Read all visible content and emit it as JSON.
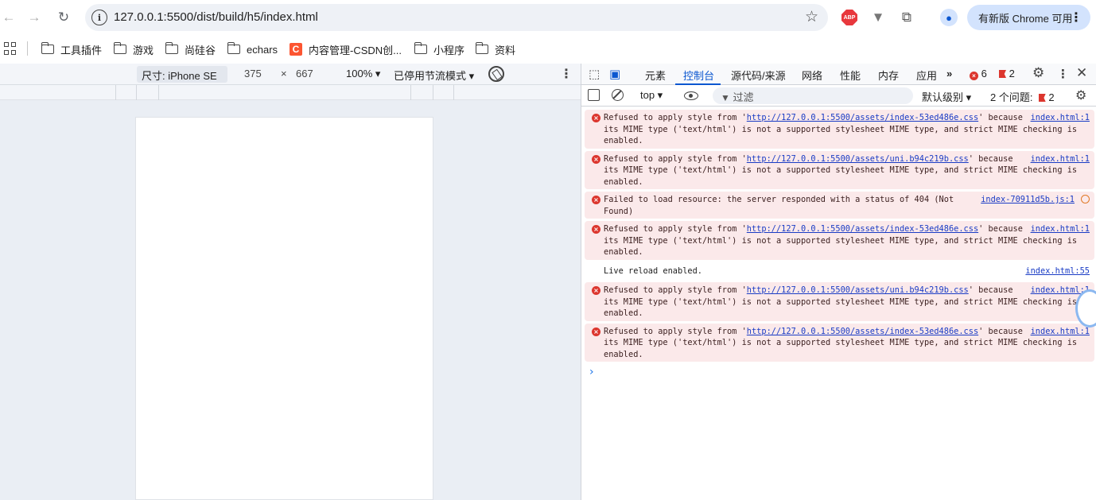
{
  "browser": {
    "url": "127.0.0.1:5500/dist/build/h5/index.html",
    "update_label": "有新版 Chrome 可用",
    "ext_abp": "ABP"
  },
  "bookmarks": [
    {
      "label": "工具插件",
      "icon": "folder-icon"
    },
    {
      "label": "游戏",
      "icon": "folder-icon"
    },
    {
      "label": "尚硅谷",
      "icon": "folder-icon"
    },
    {
      "label": "echars",
      "icon": "folder-icon"
    },
    {
      "label": "内容管理-CSDN创...",
      "icon": "csdn-icon"
    },
    {
      "label": "小程序",
      "icon": "folder-icon"
    },
    {
      "label": "资料",
      "icon": "folder-icon"
    }
  ],
  "device_toolbar": {
    "size_label": "尺寸: iPhone SE ▾",
    "width": "375",
    "times": "×",
    "height": "667",
    "zoom": "100% ▾",
    "throttle": "已停用节流模式 ▾"
  },
  "devtools": {
    "tabs": [
      "元素",
      "控制台",
      "源代码/来源",
      "网络",
      "性能",
      "内存",
      "应用"
    ],
    "active_tab": "控制台",
    "more_tabs": "»",
    "error_count": "6",
    "warn_count": "2",
    "context": "top ▾",
    "filter_placeholder": "过滤",
    "level": "默认级别 ▾",
    "issues_label": "2 个问题:",
    "issues_count": "2"
  },
  "console": [
    {
      "type": "error",
      "pre": "Refused to apply style from '",
      "link": "http://127.0.0.1:5500/assets/index-53ed486e.css",
      "post": "' because its MIME type ('text/html') is not a supported stylesheet MIME type, and strict MIME checking is enabled.",
      "src": "index.html:1"
    },
    {
      "type": "error",
      "pre": "Refused to apply style from '",
      "link": "http://127.0.0.1:5500/assets/uni.b94c219b.css",
      "post": "' because its MIME type ('text/html') is not a supported stylesheet MIME type, and strict MIME checking is enabled.",
      "src": "index.html:1"
    },
    {
      "type": "error",
      "pre": "Failed to load resource: the server responded with a status of 404 (Not Found)",
      "link": "",
      "post": "",
      "src": "index-70911d5b.js:1"
    },
    {
      "type": "error",
      "pre": "Refused to apply style from '",
      "link": "http://127.0.0.1:5500/assets/index-53ed486e.css",
      "post": "' because its MIME type ('text/html') is not a supported stylesheet MIME type, and strict MIME checking is enabled.",
      "src": "index.html:1"
    },
    {
      "type": "info",
      "pre": "Live reload enabled.",
      "link": "",
      "post": "",
      "src": "index.html:55"
    },
    {
      "type": "error",
      "pre": "Refused to apply style from '",
      "link": "http://127.0.0.1:5500/assets/uni.b94c219b.css",
      "post": "' because its MIME type ('text/html') is not a supported stylesheet MIME type, and strict MIME checking is enabled.",
      "src": "index.html:1"
    },
    {
      "type": "error",
      "pre": "Refused to apply style from '",
      "link": "http://127.0.0.1:5500/assets/index-53ed486e.css",
      "post": "' because its MIME type ('text/html') is not a supported stylesheet MIME type, and strict MIME checking is enabled.",
      "src": "index.html:1"
    }
  ],
  "prompt_symbol": "›"
}
